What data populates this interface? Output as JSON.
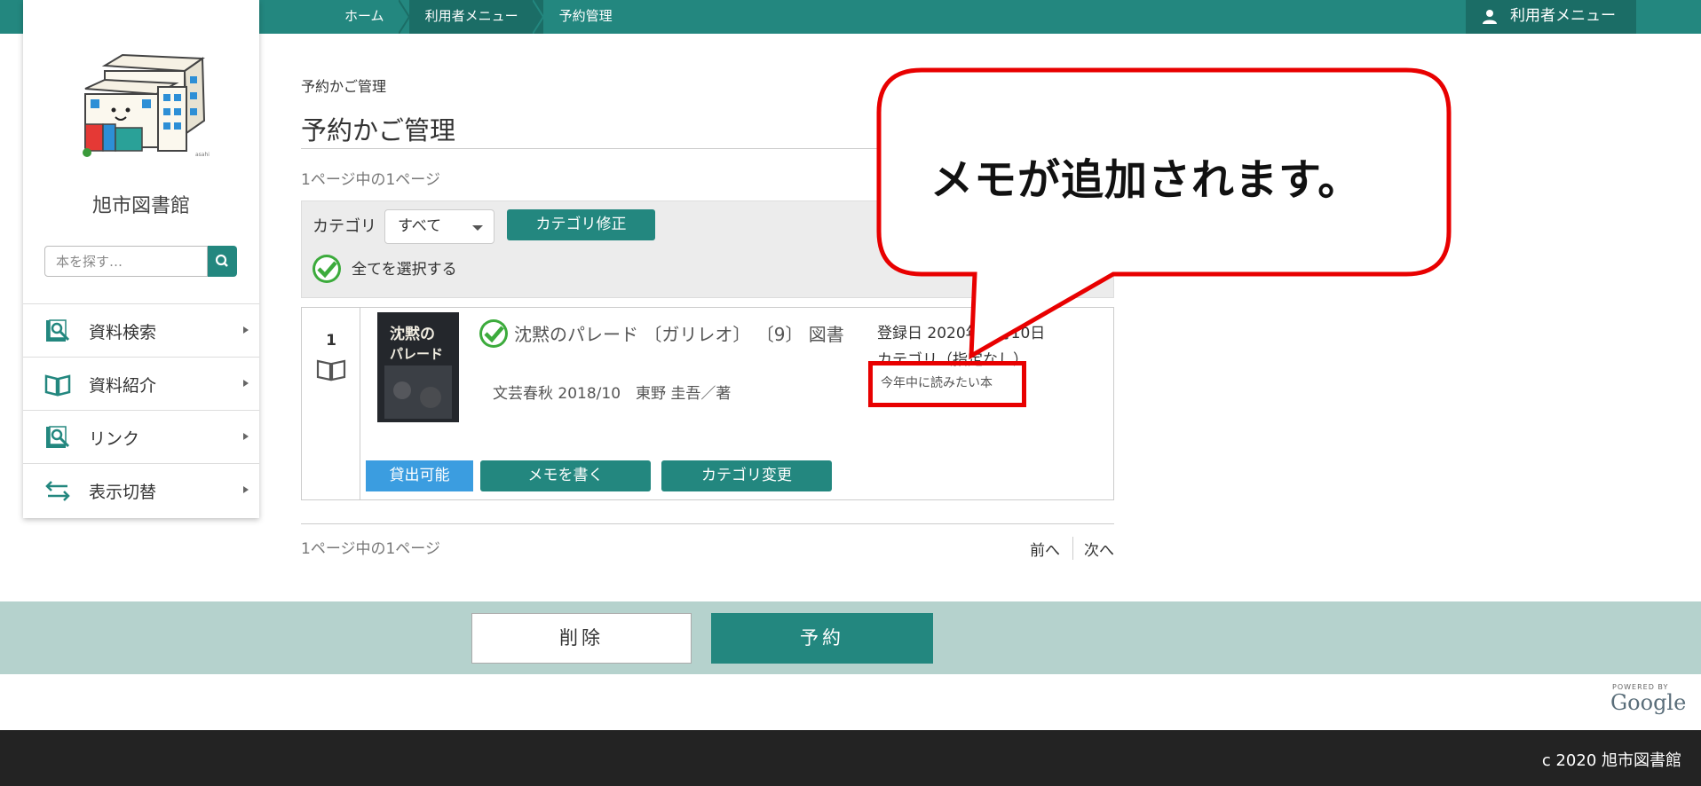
{
  "breadcrumb": {
    "home": "ホーム",
    "user_menu": "利用者メニュー",
    "current": "予約管理"
  },
  "header": {
    "user_menu_label": "利用者メニュー"
  },
  "sidebar": {
    "library_name": "旭市図書館",
    "search": {
      "placeholder": "本を探す…"
    },
    "items": [
      {
        "label": "資料検索",
        "icon": "magnifier-book-icon"
      },
      {
        "label": "資料紹介",
        "icon": "open-book-icon"
      },
      {
        "label": "リンク",
        "icon": "magnifier-book-icon"
      },
      {
        "label": "表示切替",
        "icon": "swap-arrows-icon"
      }
    ]
  },
  "main": {
    "page_title_small": "予約かご管理",
    "page_title": "予約かご管理",
    "page_count_top": "1ページ中の1ページ",
    "page_count_bottom": "1ページ中の1ページ",
    "category_label": "カテゴリ",
    "category_selected": "すべて",
    "category_edit_button": "カテゴリ修正",
    "select_all_label": "全てを選択する",
    "pager": {
      "prev": "前へ",
      "next": "次へ"
    }
  },
  "item": {
    "number": "1",
    "title": "沈黙のパレード 〔ガリレオ〕 〔9〕 図書",
    "publication": "文芸春秋 2018/10　東野 圭吾／著",
    "registered": "登録日 2020年　月10日",
    "category": "カテゴリ（指定なし）",
    "memo": "今年中に読みたい本",
    "status": "貸出可能",
    "write_memo_button": "メモを書く",
    "change_category_button": "カテゴリ変更",
    "cover_text": "沈黙のパレード"
  },
  "actions": {
    "delete": "削除",
    "reserve": "予約"
  },
  "powered": {
    "by": "POWERED BY",
    "brand": "Google"
  },
  "footer": {
    "copyright": "c 2020 旭市図書館"
  },
  "callout": {
    "text": "メモが追加されます。"
  },
  "colors": {
    "brand_teal": "#23877f",
    "dark_teal": "#1b6d66",
    "status_blue": "#3b9de0",
    "highlight_red": "#e80000",
    "action_bar": "#b5d2cd",
    "footer": "#232323"
  }
}
